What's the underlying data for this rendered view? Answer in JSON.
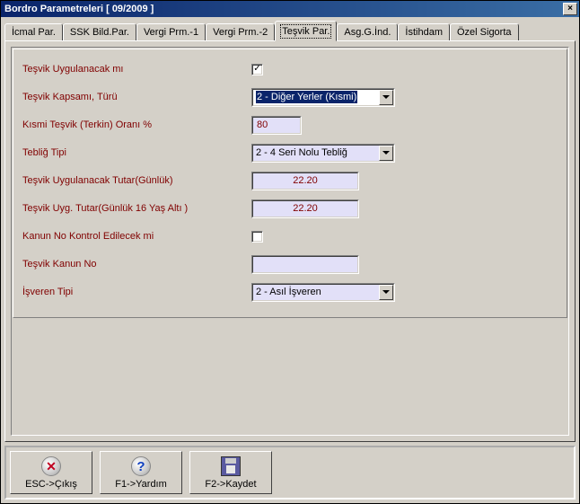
{
  "window": {
    "title": "Bordro Parametreleri [ 09/2009  ]",
    "close_symbol": "×"
  },
  "tabs": [
    {
      "label": "İcmal Par."
    },
    {
      "label": "SSK Bild.Par."
    },
    {
      "label": "Vergi Prm.-1"
    },
    {
      "label": "Vergi Prm.-2"
    },
    {
      "label": "Teşvik Par."
    },
    {
      "label": "Asg.G.İnd."
    },
    {
      "label": "İstihdam"
    },
    {
      "label": "Özel Sigorta"
    }
  ],
  "active_tab_index": 4,
  "form": {
    "tesvik_uygulanacak": {
      "label": "Teşvik Uygulanacak mı",
      "checked": true
    },
    "tesvik_kapsami": {
      "label": "Teşvik Kapsamı, Türü",
      "value": "2 - Diğer Yerler (Kısmi)"
    },
    "kismi_tesvik_oran": {
      "label": "Kısmi Teşvik (Terkin) Oranı %",
      "value": "80"
    },
    "teblig_tipi": {
      "label": "Tebliğ Tipi",
      "value": "2 - 4 Seri Nolu Tebliğ"
    },
    "tesvik_tutar": {
      "label": "Teşvik Uygulanacak Tutar(Günlük)",
      "value": "22.20"
    },
    "tesvik_tutar_16": {
      "label": "Teşvik Uyg. Tutar(Günlük 16 Yaş Altı )",
      "value": "22.20"
    },
    "kanun_kontrol": {
      "label": "Kanun No Kontrol Edilecek mi",
      "checked": false
    },
    "tesvik_kanun_no": {
      "label": "Teşvik Kanun No",
      "value": ""
    },
    "isveren_tipi": {
      "label": "İşveren Tipi",
      "value": "2 - Asıl İşveren"
    }
  },
  "buttons": {
    "esc": {
      "label": "ESC->Çıkış"
    },
    "f1": {
      "label": "F1->Yardım"
    },
    "f2": {
      "label": "F2->Kaydet"
    }
  }
}
